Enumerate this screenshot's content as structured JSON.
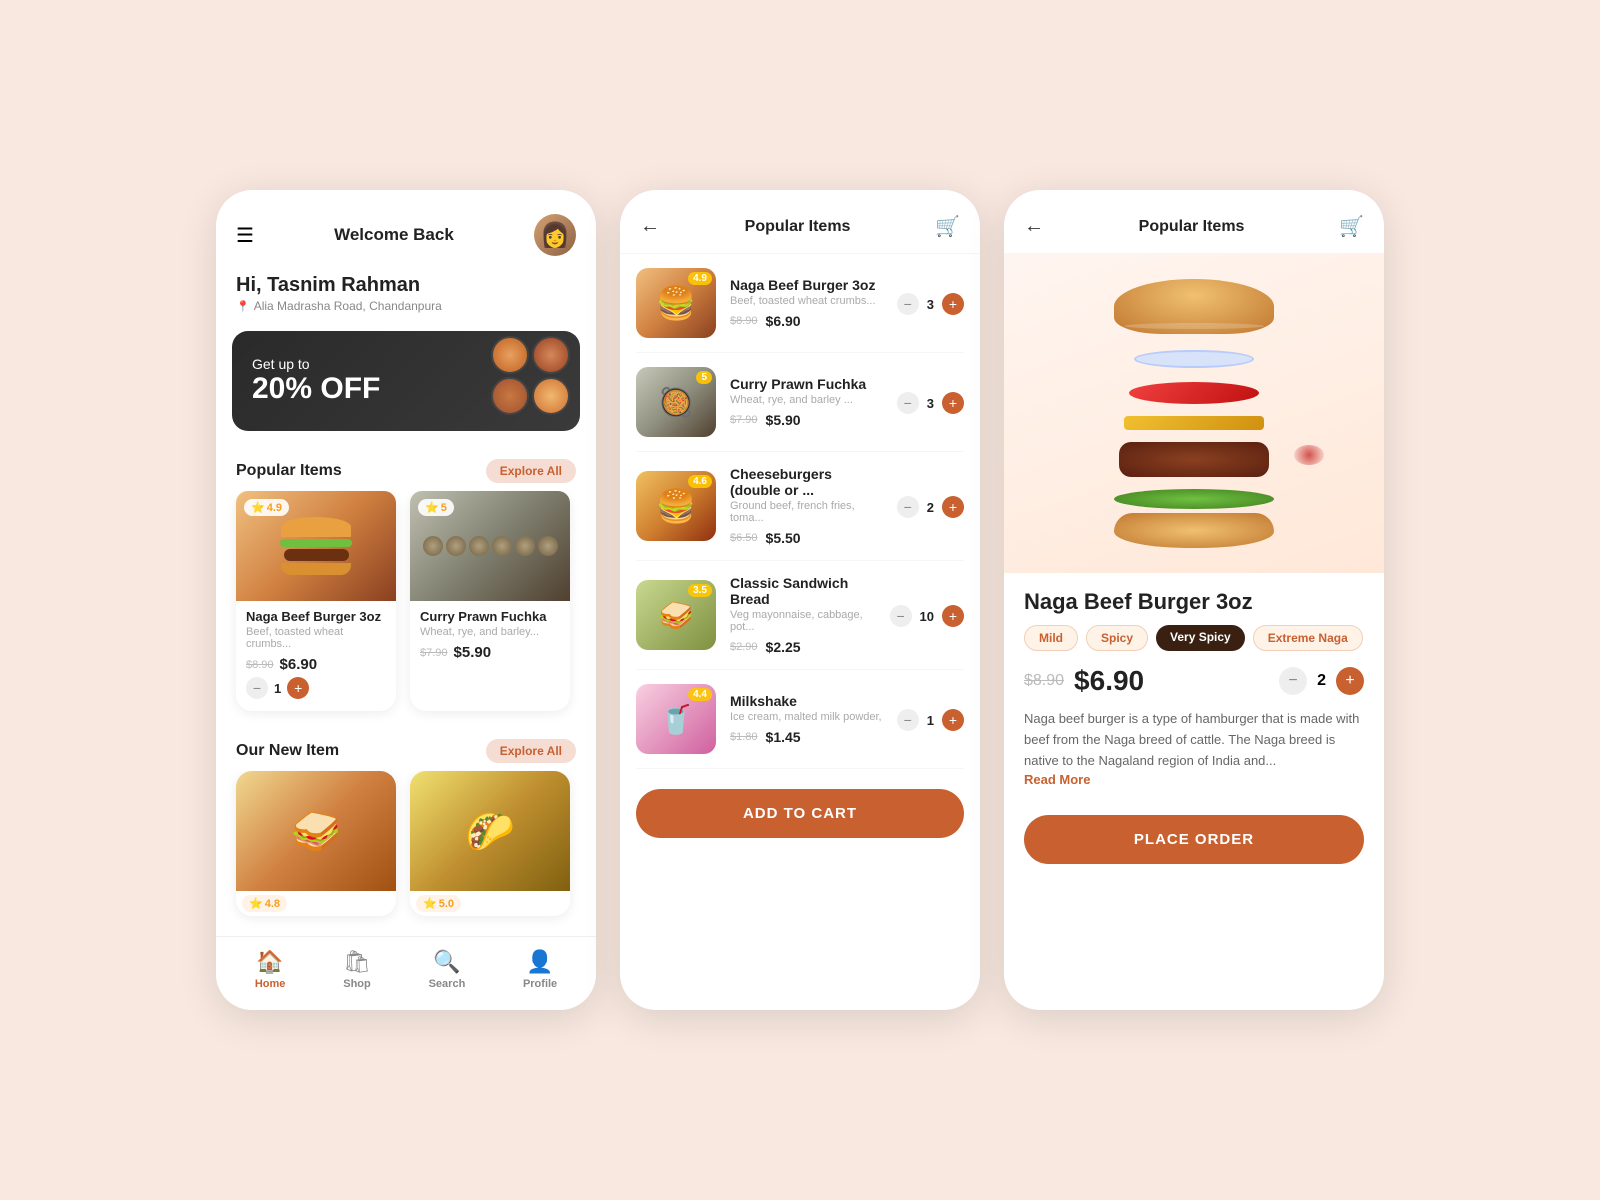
{
  "app": {
    "brand_color": "#c86030",
    "bg_color": "#f8e8e0"
  },
  "left_phone": {
    "header": {
      "title": "Welcome Back",
      "menu_icon": "☰",
      "avatar_emoji": "👩"
    },
    "greeting": {
      "hi_text": "Hi, Tasnim Rahman",
      "location": "Alia Madrasha Road, Chandanpura"
    },
    "banner": {
      "line1": "Get up to",
      "line2": "20% OFF"
    },
    "popular_section": {
      "title": "Popular Items",
      "explore_label": "Explore All"
    },
    "popular_items": [
      {
        "name": "Naga Beef Burger 3oz",
        "desc": "Beef, toasted wheat crumbs...",
        "old_price": "$8.90",
        "new_price": "$6.90",
        "rating": "4.9",
        "qty": "1"
      },
      {
        "name": "Curry Prawn Fuchka",
        "desc": "Wheat, rye, and barley...",
        "old_price": "$7.90",
        "new_price": "$5.90",
        "rating": "5",
        "qty": ""
      }
    ],
    "new_section": {
      "title": "Our New Item",
      "explore_label": "Explore All"
    },
    "new_items": [
      {
        "name": "Sandwich",
        "rating": "4.8"
      },
      {
        "name": "Tacos",
        "rating": "5.0"
      }
    ],
    "nav": [
      {
        "label": "Home",
        "icon": "🏠",
        "active": true
      },
      {
        "label": "Shop",
        "icon": "🛍",
        "active": false
      },
      {
        "label": "Search",
        "icon": "🔍",
        "active": false
      },
      {
        "label": "Profile",
        "icon": "👤",
        "active": false
      }
    ]
  },
  "middle_phone": {
    "header": {
      "title": "Popular Items",
      "back_icon": "←",
      "cart_icon": "🛒"
    },
    "items": [
      {
        "name": "Naga Beef Burger 3oz",
        "desc": "Beef, toasted wheat crumbs...",
        "old_price": "$8.90",
        "new_price": "$6.90",
        "rating": "4.9",
        "qty": "3",
        "thumb_class": "thumb-burger"
      },
      {
        "name": "Curry Prawn Fuchka",
        "desc": "Wheat, rye, and barley ...",
        "old_price": "$7.90",
        "new_price": "$5.90",
        "rating": "5",
        "qty": "3",
        "thumb_class": "thumb-fuchka"
      },
      {
        "name": "Cheeseburgers (double or ...",
        "desc": "Ground beef, french fries, toma...",
        "old_price": "$6.50",
        "new_price": "$5.50",
        "rating": "4.6",
        "qty": "2",
        "thumb_class": "thumb-cheese"
      },
      {
        "name": "Classic Sandwich Bread",
        "desc": "Veg mayonnaise, cabbage, pot...",
        "old_price": "$2.90",
        "new_price": "$2.25",
        "rating": "3.5",
        "qty": "10",
        "thumb_class": "thumb-sandwich"
      },
      {
        "name": "Milkshake",
        "desc": "Ice cream, malted milk powder,",
        "old_price": "$1.80",
        "new_price": "$1.45",
        "rating": "4.4",
        "qty": "1",
        "thumb_class": "thumb-milkshake"
      }
    ],
    "add_to_cart_label": "ADD TO CART"
  },
  "right_phone": {
    "header": {
      "title": "Popular Items",
      "back_icon": "←",
      "cart_icon": "🛒"
    },
    "product": {
      "name": "Naga Beef Burger 3oz",
      "old_price": "$8.90",
      "new_price": "$6.90",
      "qty": "2",
      "description": "Naga beef burger is a type of hamburger that is made with beef from the Naga breed of cattle. The Naga breed is native to the Nagaland region of India and...",
      "read_more": "Read More",
      "spice_levels": [
        {
          "label": "Mild",
          "active": false
        },
        {
          "label": "Spicy",
          "active": false
        },
        {
          "label": "Very Spicy",
          "active": true
        },
        {
          "label": "Extreme Naga",
          "active": false
        }
      ],
      "place_order_label": "PLACE ORDER"
    }
  }
}
